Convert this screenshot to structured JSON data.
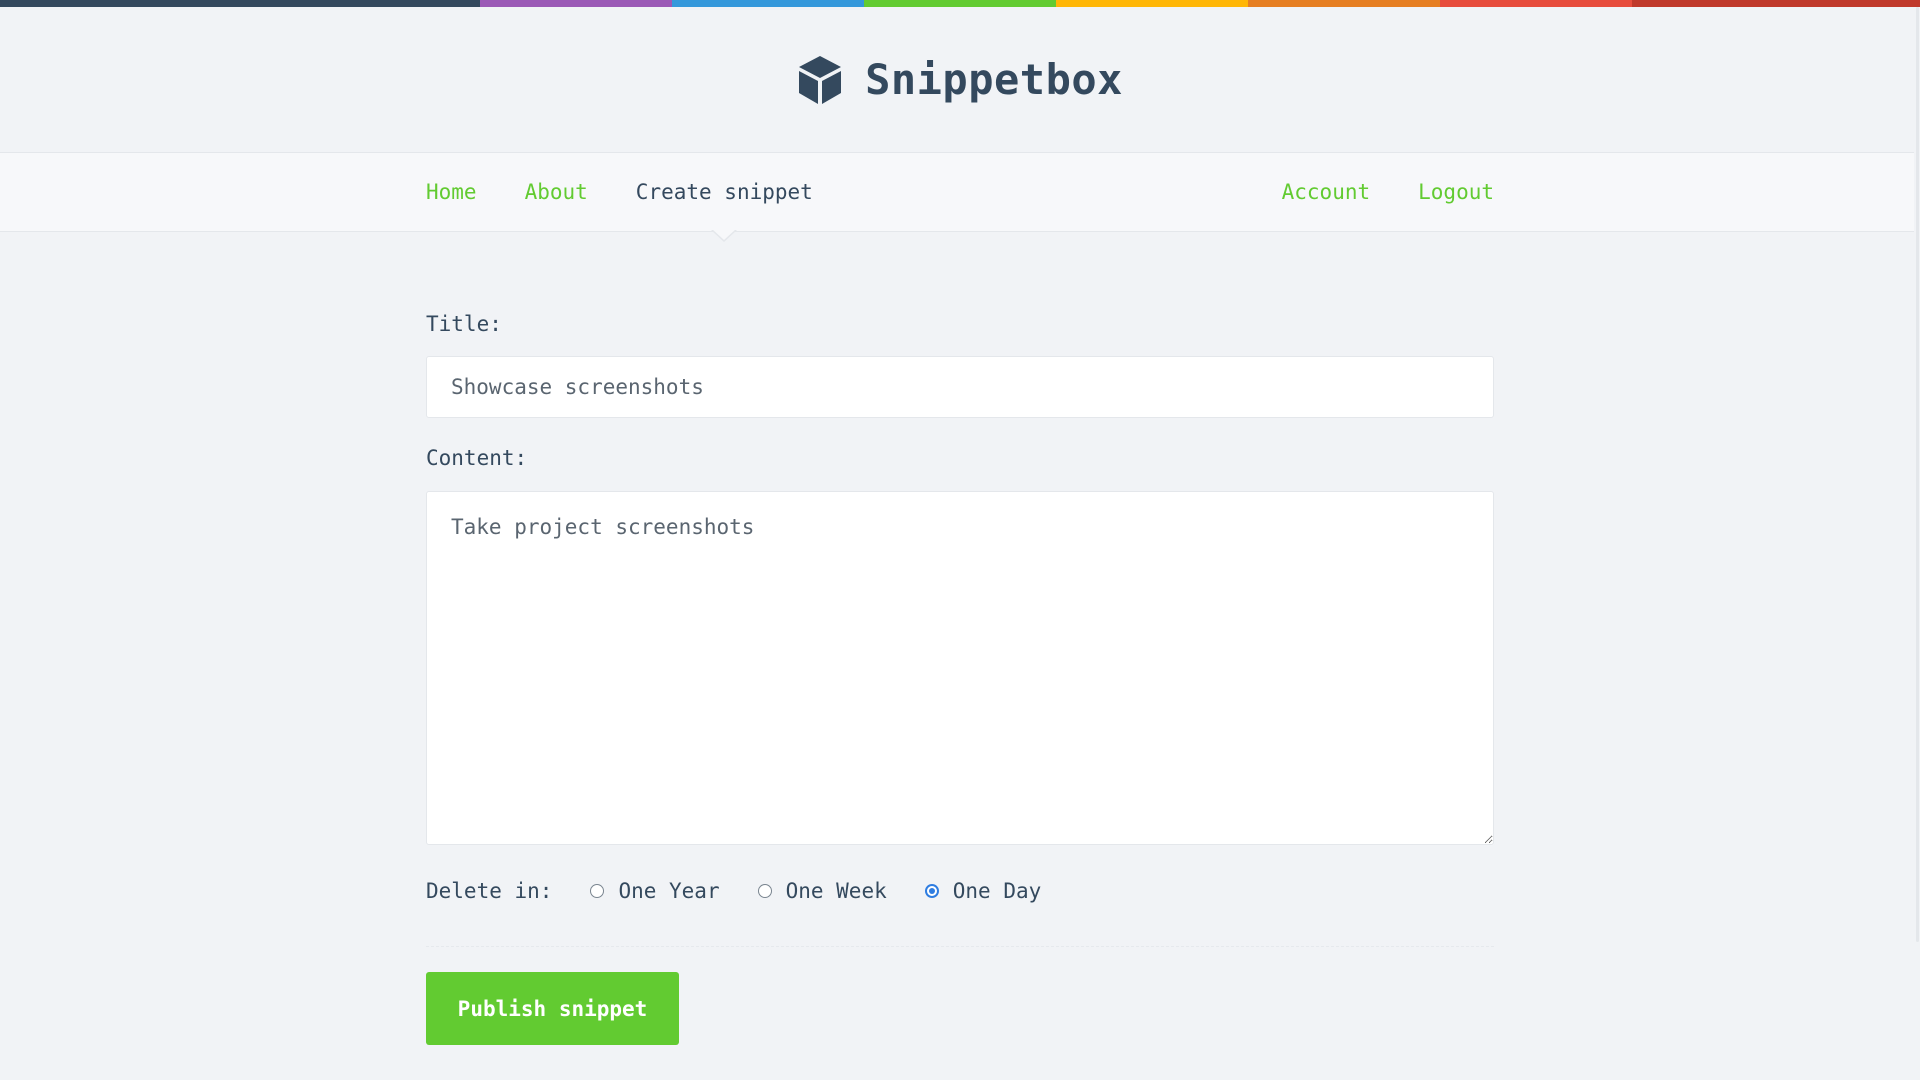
{
  "theme": {
    "rainbow": [
      "#34495e",
      "#9b59b6",
      "#3498db",
      "#62cb31",
      "#ffb606",
      "#e67e22",
      "#e74c3c",
      "#c0392b"
    ],
    "accent": "#62cb31",
    "text": "#34495e",
    "radio_checked": "#2f7de1"
  },
  "site": {
    "title": "Snippetbox",
    "logo_icon": "cube-icon"
  },
  "nav": {
    "left": [
      {
        "label": "Home",
        "active": false
      },
      {
        "label": "About",
        "active": false
      },
      {
        "label": "Create snippet",
        "active": true
      }
    ],
    "right": [
      {
        "label": "Account"
      },
      {
        "label": "Logout"
      }
    ]
  },
  "form": {
    "title_label": "Title:",
    "title_value": "Showcase screenshots",
    "content_label": "Content:",
    "content_value": "Take project screenshots",
    "expires_label": "Delete in:",
    "expires_options": [
      {
        "label": "One Year",
        "checked": false
      },
      {
        "label": "One Week",
        "checked": false
      },
      {
        "label": "One Day",
        "checked": true
      }
    ],
    "submit_label": "Publish snippet"
  }
}
